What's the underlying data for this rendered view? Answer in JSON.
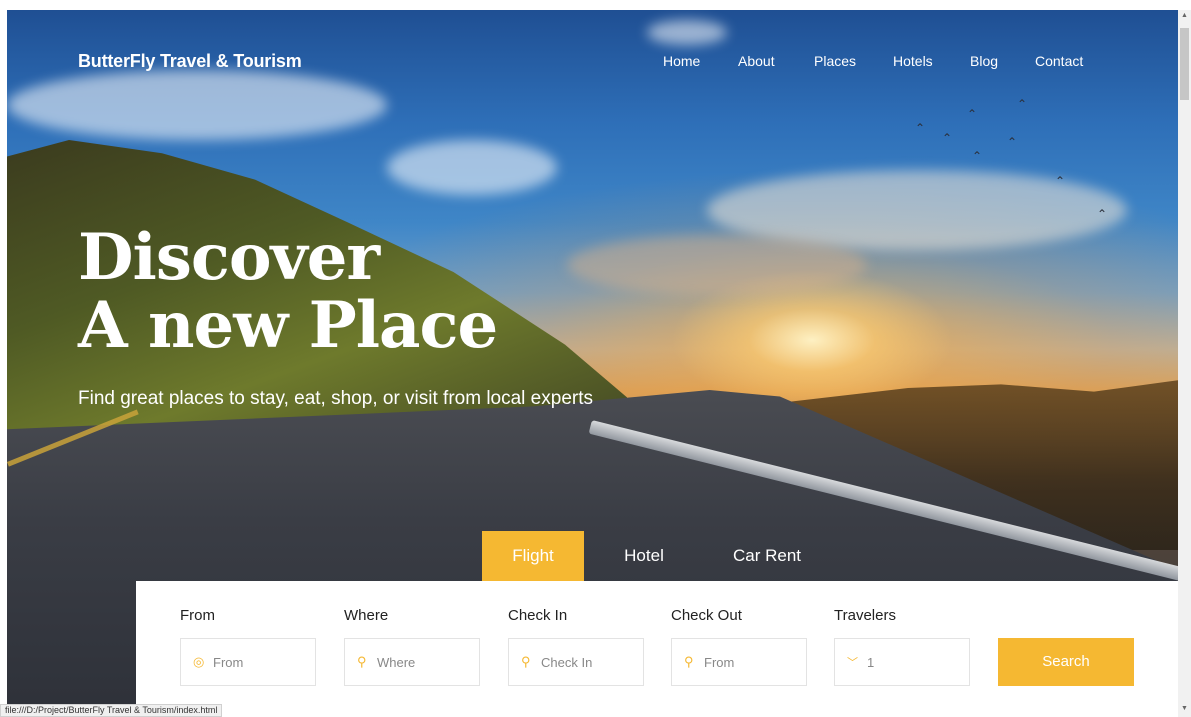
{
  "brand": {
    "name": "ButterFly Travel & Tourism"
  },
  "nav": {
    "items": [
      {
        "label": "Home"
      },
      {
        "label": "About"
      },
      {
        "label": "Places"
      },
      {
        "label": "Hotels"
      },
      {
        "label": "Blog"
      },
      {
        "label": "Contact"
      }
    ]
  },
  "hero": {
    "headline_line1": "Discover",
    "headline_line2": "A new Place",
    "subheadline": "Find great places to stay, eat, shop, or visit from local experts"
  },
  "tabs": [
    {
      "label": "Flight",
      "active": true
    },
    {
      "label": "Hotel",
      "active": false
    },
    {
      "label": "Car Rent",
      "active": false
    }
  ],
  "search_form": {
    "fields": [
      {
        "label": "From",
        "placeholder": "From",
        "icon": "target-icon"
      },
      {
        "label": "Where",
        "placeholder": "Where",
        "icon": "map-pin-icon"
      },
      {
        "label": "Check In",
        "placeholder": "Check In",
        "icon": "map-pin-icon"
      },
      {
        "label": "Check Out",
        "placeholder": "From",
        "icon": "map-pin-icon"
      },
      {
        "label": "Travelers",
        "value": "1",
        "icon": "chevron-down-icon"
      }
    ],
    "button_label": "Search"
  },
  "status_bar": {
    "url": "file:///D:/Project/ButterFly Travel & Tourism/index.html"
  },
  "colors": {
    "accent": "#f5b832",
    "text_white": "#ffffff",
    "label_dark": "#222222"
  }
}
